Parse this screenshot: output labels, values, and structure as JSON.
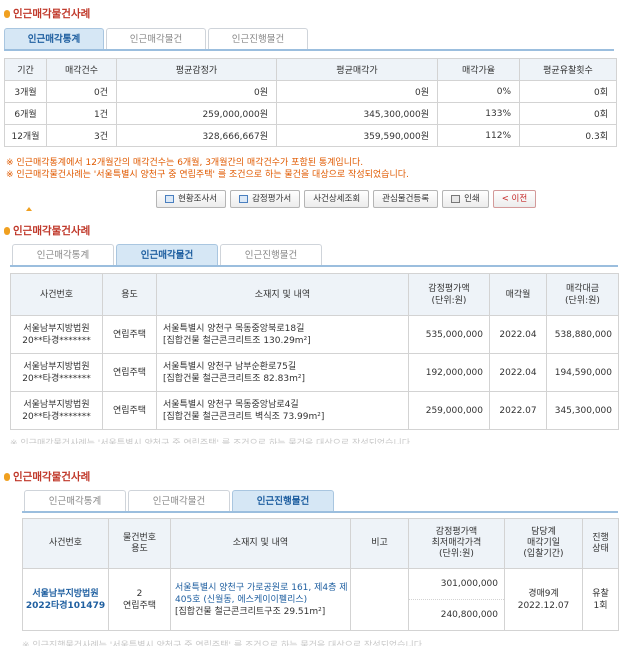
{
  "section1": {
    "title": "인근매각물건사례",
    "tabs": [
      "인근매각통계",
      "인근매각물건",
      "인근진행물건"
    ],
    "headers": [
      "기간",
      "매각건수",
      "평균감정가",
      "평균매각가",
      "매각가율",
      "평균유찰횟수"
    ],
    "rows": [
      [
        "3개월",
        "0건",
        "0원",
        "0원",
        "0%",
        "0회"
      ],
      [
        "6개월",
        "1건",
        "259,000,000원",
        "345,300,000원",
        "133%",
        "0회"
      ],
      [
        "12개월",
        "3건",
        "328,666,667원",
        "359,590,000원",
        "112%",
        "0.3회"
      ]
    ],
    "notes": [
      "※ 인근매각통계에서 12개월간의 매각건수는 6개월, 3개월간의 매각건수가 포함된 통계입니다.",
      "※ 인근매각물건사례는 '서울특별시 양천구 중 연립주택' 를 조건으로 하는 물건을 대상으로 작성되었습니다."
    ]
  },
  "buttons": [
    "현황조사서",
    "감정평가서",
    "사건상세조회",
    "관심물건등록",
    "인쇄",
    "< 이전"
  ],
  "section2": {
    "title": "인근매각물건사례",
    "tabs": [
      "인근매각통계",
      "인근매각물건",
      "인근진행물건"
    ],
    "headers": [
      "사건번호",
      "용도",
      "소재지 및 내역",
      "감정평가액\n(단위:원)",
      "매각월",
      "매각대금\n(단위:원)"
    ],
    "rows": [
      {
        "court": "서울남부지방법원",
        "case": "20**타경*******",
        "use": "연립주택",
        "addr1": "서울특별시 양천구 목동중앙북로18길",
        "addr2": "[집합건물 철근콘크리트조 130.29m²]",
        "appraisal": "535,000,000",
        "month": "2022.04",
        "price": "538,880,000"
      },
      {
        "court": "서울남부지방법원",
        "case": "20**타경*******",
        "use": "연립주택",
        "addr1": "서울특별시 양천구 남부순환로75길",
        "addr2": "[집합건물 철근콘크리트조 82.83m²]",
        "appraisal": "192,000,000",
        "month": "2022.04",
        "price": "194,590,000"
      },
      {
        "court": "서울남부지방법원",
        "case": "20**타경*******",
        "use": "연립주택",
        "addr1": "서울특별시 양천구 목동중앙남로4길",
        "addr2": "[집합건물 철근콘크리트 벽식조 73.99m²]",
        "appraisal": "259,000,000",
        "month": "2022.07",
        "price": "345,300,000"
      }
    ],
    "faint_note": "※ 인근매각물건사례는 '서울특별시 양천구 중 연립주택' 를 조건으로 하는 물건을 대상으로 작성되었습니다."
  },
  "section3": {
    "title": "인근매각물건사례",
    "tabs": [
      "인근매각통계",
      "인근매각물건",
      "인근진행물건"
    ],
    "headers": [
      "사건번호",
      "물건번호\n용도",
      "소재지 및 내역",
      "비고",
      "감정평가액\n최저매각가격\n(단위:원)",
      "담당계\n매각기일\n(입찰기간)",
      "진행\n상태"
    ],
    "row": {
      "court": "서울남부지방법원",
      "case": "2022타경101479",
      "item_no": "2",
      "use": "연립주택",
      "addr1": "서울특별시 양천구 가로공원로 161, 제4층 제405호 (신월동, 에스케이이펠리스)",
      "addr2": "[집합건물 철근콘크리트구조 29.51m²]",
      "remark": "",
      "appraisal": "301,000,000",
      "min_price": "240,800,000",
      "dept": "경매9계",
      "date": "2022.12.07",
      "status1": "유찰",
      "status2": "1회"
    },
    "faint_note": "※ 인근진행물건사례는 '서울특별시 양천구 중 연립주택' 를 조건으로 하는 물건을 대상으로 작성되었습니다."
  },
  "colors": {
    "accent_red": "#c0392b",
    "note_orange": "#e05a00",
    "tab_active": "#d6e7f5",
    "link_blue": "#1f5fa0"
  }
}
